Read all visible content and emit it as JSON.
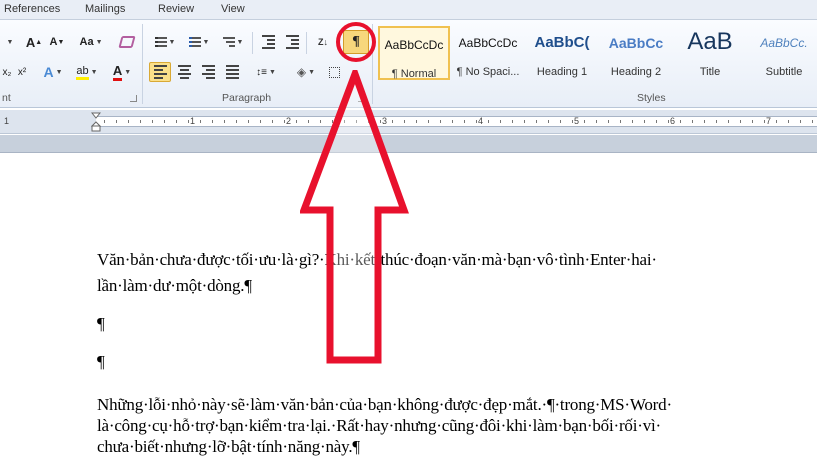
{
  "tabs": [
    "References",
    "Mailings",
    "Review",
    "View"
  ],
  "ribbon": {
    "font_group_label": "nt",
    "paragraph_group_label": "Paragraph",
    "styles_group_label": "Styles",
    "show_hide_symbol": "¶",
    "font_buttons": {
      "grow_font": "A",
      "shrink_font": "A",
      "change_case": "Aa",
      "text_effects": "A",
      "highlight": "ab",
      "font_color": "A"
    },
    "sort_label": "Z↓"
  },
  "styles": [
    {
      "sample": "AaBbCcDc",
      "name": "¶ Normal",
      "selected": true
    },
    {
      "sample": "AaBbCcDc",
      "name": "¶ No Spaci...",
      "selected": false
    },
    {
      "sample": "AaBbC(",
      "name": "Heading 1",
      "selected": false
    },
    {
      "sample": "AaBbCc",
      "name": "Heading 2",
      "selected": false
    },
    {
      "sample": "AaB",
      "name": "Title",
      "selected": false
    },
    {
      "sample": "AaBbCc.",
      "name": "Subtitle",
      "selected": false
    }
  ],
  "ruler": {
    "numbers": [
      "1",
      "1",
      "2",
      "3",
      "4",
      "5",
      "6",
      "7"
    ]
  },
  "document": {
    "lines": [
      "Văn·bản·chưa·được·tối·ưu·là·gì?·Khi·kết·thúc·đoạn·văn·mà·bạn·vô·tình·Enter·hai·",
      "lần·làm·dư·một·dòng.¶",
      "¶",
      "¶",
      "Những·lỗi·nhỏ·này·sẽ·làm·văn·bản·của·bạn·không·được·đẹp·mắt.·¶·trong·MS·Word·",
      "là·công·cụ·hỗ·trợ·bạn·kiểm·tra·lại.·Rất·hay·nhưng·cũng·đôi·khi·làm·bạn·bối·rối·vì·",
      "chưa·biết·nhưng·lỡ·bật·tính·năng·này.¶"
    ]
  },
  "colors": {
    "annotation_red": "#e8112d",
    "active_button": "#f7d77c",
    "ribbon_bg": "#e8eef7"
  }
}
